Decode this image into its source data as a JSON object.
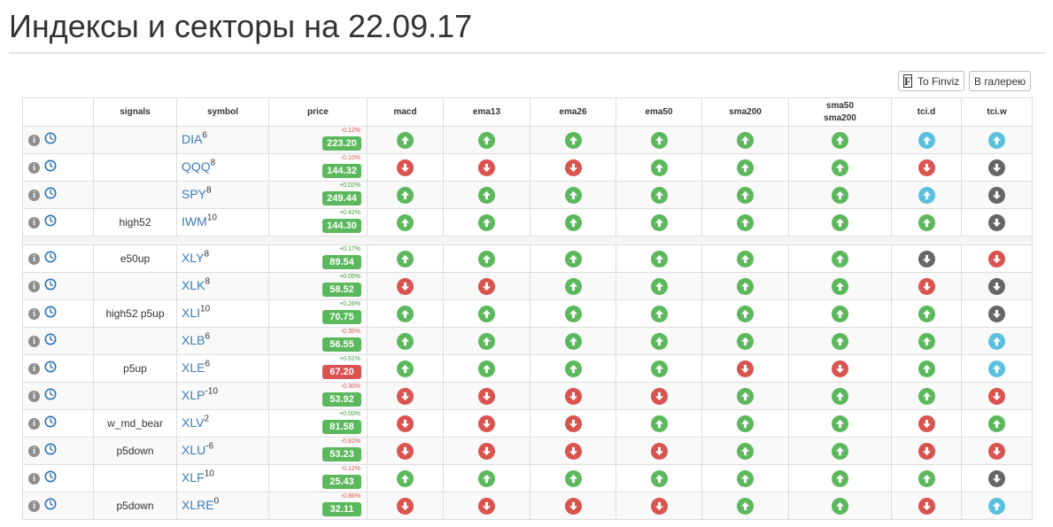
{
  "page": {
    "title": "Индексы и секторы на 22.09.17",
    "finviz_button": "To Finviz",
    "finviz_icon_letter": "F",
    "gallery_button": "В галерею"
  },
  "table": {
    "headers": {
      "signals": "signals",
      "symbol": "symbol",
      "price": "price",
      "macd": "macd",
      "ema13": "ema13",
      "ema26": "ema26",
      "ema50": "ema50",
      "sma200": "sma200",
      "sma50_sma200_line1": "sma50",
      "sma50_sma200_line2": "sma200",
      "tci_d": "tci.d",
      "tci_w": "tci.w"
    },
    "indicator_keys": [
      "macd",
      "ema13",
      "ema26",
      "ema50",
      "sma200",
      "sma50_sma200",
      "tci_d",
      "tci_w"
    ],
    "status_colors": {
      "up_green": "#5cb85c",
      "down_red": "#d9534f",
      "up_blue": "#5bc0de",
      "down_gray": "#666666"
    },
    "badge_colors": {
      "green": "#5cb85c",
      "red": "#d9534f"
    },
    "info_icon_glyph": "i",
    "groups": [
      [
        {
          "signals": "",
          "symbol": "DIA",
          "sup": "6",
          "price": "223.20",
          "change": "-0.12%",
          "change_dir": "neg",
          "badge": "green",
          "ind": [
            "up_green",
            "up_green",
            "up_green",
            "up_green",
            "up_green",
            "up_green",
            "up_blue",
            "up_blue"
          ]
        },
        {
          "signals": "",
          "symbol": "QQQ",
          "sup": "8",
          "price": "144.32",
          "change": "-0.10%",
          "change_dir": "neg",
          "badge": "green",
          "ind": [
            "down_red",
            "down_red",
            "down_red",
            "up_green",
            "up_green",
            "up_green",
            "down_red",
            "down_gray"
          ]
        },
        {
          "signals": "",
          "symbol": "SPY",
          "sup": "8",
          "price": "249.44",
          "change": "+0.02%",
          "change_dir": "pos",
          "badge": "green",
          "ind": [
            "up_green",
            "up_green",
            "up_green",
            "up_green",
            "up_green",
            "up_green",
            "up_blue",
            "down_gray"
          ]
        },
        {
          "signals": "high52",
          "symbol": "IWM",
          "sup": "10",
          "price": "144.30",
          "change": "+0.42%",
          "change_dir": "pos",
          "badge": "green",
          "ind": [
            "up_green",
            "up_green",
            "up_green",
            "up_green",
            "up_green",
            "up_green",
            "up_green",
            "down_gray"
          ]
        }
      ],
      [
        {
          "signals": "e50up",
          "symbol": "XLY",
          "sup": "8",
          "price": "89.54",
          "change": "+0.17%",
          "change_dir": "pos",
          "badge": "green",
          "ind": [
            "up_green",
            "up_green",
            "up_green",
            "up_green",
            "up_green",
            "up_green",
            "down_gray",
            "down_red"
          ]
        },
        {
          "signals": "",
          "symbol": "XLK",
          "sup": "8",
          "price": "58.52",
          "change": "+0.05%",
          "change_dir": "pos",
          "badge": "green",
          "ind": [
            "down_red",
            "down_red",
            "up_green",
            "up_green",
            "up_green",
            "up_green",
            "down_red",
            "down_gray"
          ]
        },
        {
          "signals": "high52 p5up",
          "symbol": "XLI",
          "sup": "10",
          "price": "70.75",
          "change": "+0.26%",
          "change_dir": "pos",
          "badge": "green",
          "ind": [
            "up_green",
            "up_green",
            "up_green",
            "up_green",
            "up_green",
            "up_green",
            "up_green",
            "down_gray"
          ]
        },
        {
          "signals": "",
          "symbol": "XLB",
          "sup": "6",
          "price": "56.55",
          "change": "-0.35%",
          "change_dir": "neg",
          "badge": "green",
          "ind": [
            "up_green",
            "up_green",
            "up_green",
            "up_green",
            "up_green",
            "up_green",
            "up_green",
            "up_blue"
          ]
        },
        {
          "signals": "p5up",
          "symbol": "XLE",
          "sup": "6",
          "price": "67.20",
          "change": "+0.51%",
          "change_dir": "pos",
          "badge": "red",
          "ind": [
            "up_green",
            "up_green",
            "up_green",
            "up_green",
            "down_red",
            "down_red",
            "up_green",
            "up_blue"
          ]
        },
        {
          "signals": "",
          "symbol": "XLP",
          "sup": "-10",
          "price": "53.92",
          "change": "-0.30%",
          "change_dir": "neg",
          "badge": "green",
          "ind": [
            "down_red",
            "down_red",
            "down_red",
            "down_red",
            "up_green",
            "up_green",
            "up_green",
            "down_red"
          ]
        },
        {
          "signals": "w_md_bear",
          "symbol": "XLV",
          "sup": "2",
          "price": "81.58",
          "change": "+0.00%",
          "change_dir": "pos",
          "badge": "green",
          "ind": [
            "down_red",
            "down_red",
            "down_red",
            "up_green",
            "up_green",
            "up_green",
            "down_red",
            "up_green"
          ]
        },
        {
          "signals": "p5down",
          "symbol": "XLU",
          "sup": "-6",
          "price": "53.23",
          "change": "-0.82%",
          "change_dir": "neg",
          "badge": "green",
          "ind": [
            "down_red",
            "down_red",
            "down_red",
            "down_red",
            "up_green",
            "up_green",
            "down_red",
            "down_red"
          ]
        },
        {
          "signals": "",
          "symbol": "XLF",
          "sup": "10",
          "price": "25.43",
          "change": "-0.12%",
          "change_dir": "neg",
          "badge": "green",
          "ind": [
            "up_green",
            "up_green",
            "up_green",
            "up_green",
            "up_green",
            "up_green",
            "up_green",
            "down_gray"
          ]
        },
        {
          "signals": "p5down",
          "symbol": "XLRE",
          "sup": "0",
          "price": "32.11",
          "change": "-0.86%",
          "change_dir": "neg",
          "badge": "green",
          "ind": [
            "down_red",
            "down_red",
            "down_red",
            "down_red",
            "up_green",
            "up_green",
            "down_red",
            "up_blue"
          ]
        }
      ]
    ]
  }
}
